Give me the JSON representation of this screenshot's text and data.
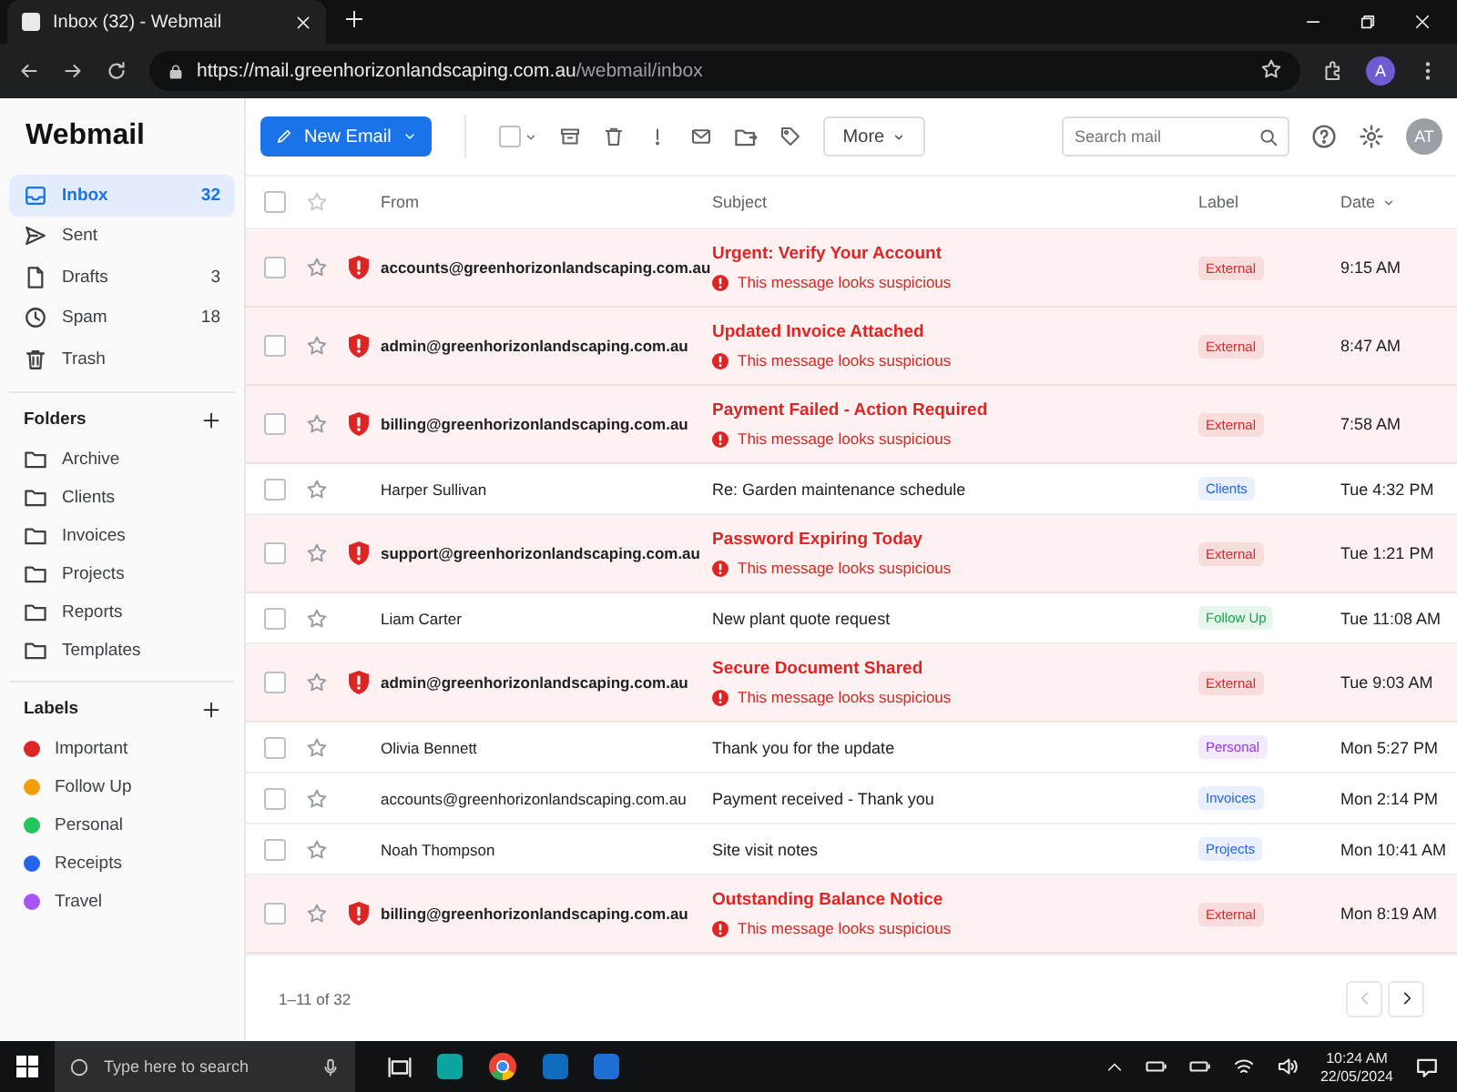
{
  "browser": {
    "tab_title": "Inbox (32) - Webmail",
    "url_host": "https://mail.greenhorizonlandscaping.com.au",
    "url_path": "/webmail/inbox",
    "profile": "A"
  },
  "app": {
    "title": "Webmail",
    "new_button": "New Email",
    "select_all": {
      "checked": false
    },
    "more_button": "More",
    "search": {
      "placeholder": "Search mail"
    },
    "avatar": "AT"
  },
  "sidebar": {
    "nav": [
      {
        "label": "Inbox",
        "count": "32",
        "selected": true,
        "kind": "inbox"
      },
      {
        "label": "Sent",
        "selected": false,
        "kind": "sent"
      },
      {
        "label": "Drafts",
        "count": "3",
        "selected": false,
        "kind": "drafts"
      },
      {
        "label": "Spam",
        "count": "18",
        "selected": false,
        "kind": "spam"
      },
      {
        "label": "Trash",
        "selected": false,
        "kind": "trash"
      }
    ],
    "folders_heading": "Folders",
    "folders": [
      "Archive",
      "Clients",
      "Invoices",
      "Projects",
      "Reports",
      "Templates"
    ],
    "labels_heading": "Labels",
    "labels": [
      {
        "name": "Important",
        "color": "#dc2626"
      },
      {
        "name": "Follow Up",
        "color": "#f59e0b"
      },
      {
        "name": "Personal",
        "color": "#22c55e"
      },
      {
        "name": "Receipts",
        "color": "#2563eb"
      },
      {
        "name": "Travel",
        "color": "#a855f7"
      }
    ]
  },
  "table": {
    "select_all": {
      "checked": false
    },
    "columns": [
      "From",
      "Subject",
      "Label",
      "Date"
    ],
    "rows": [
      {
        "checked": false,
        "from": "accounts@greenhorizonlandscaping.com.au",
        "subject": "Urgent: Verify Your Account",
        "suspicious": true,
        "warning": "This message looks suspicious",
        "label": {
          "text": "External",
          "color": "#dc2626"
        },
        "date": "9:15 AM"
      },
      {
        "checked": false,
        "from": "admin@greenhorizonlandscaping.com.au",
        "subject": "Updated Invoice Attached",
        "suspicious": true,
        "warning": "This message looks suspicious",
        "label": {
          "text": "External",
          "color": "#dc2626"
        },
        "date": "8:47 AM"
      },
      {
        "checked": false,
        "from": "billing@greenhorizonlandscaping.com.au",
        "subject": "Payment Failed - Action Required",
        "suspicious": true,
        "warning": "This message looks suspicious",
        "label": {
          "text": "External",
          "color": "#dc2626"
        },
        "date": "7:58 AM"
      },
      {
        "checked": false,
        "from": "Harper Sullivan",
        "subject": "Re: Garden maintenance schedule",
        "suspicious": false,
        "label": {
          "text": "Clients",
          "color": "#2563eb"
        },
        "date": "Tue 4:32 PM"
      },
      {
        "checked": false,
        "from": "support@greenhorizonlandscaping.com.au",
        "subject": "Password Expiring Today",
        "suspicious": true,
        "warning": "This message looks suspicious",
        "label": {
          "text": "External",
          "color": "#dc2626"
        },
        "date": "Tue 1:21 PM"
      },
      {
        "checked": false,
        "from": "Liam Carter",
        "subject": "New plant quote request",
        "suspicious": false,
        "label": {
          "text": "Follow Up",
          "color": "#16a34a"
        },
        "date": "Tue 11:08 AM"
      },
      {
        "checked": false,
        "from": "admin@greenhorizonlandscaping.com.au",
        "subject": "Secure Document Shared",
        "suspicious": true,
        "warning": "This message looks suspicious",
        "label": {
          "text": "External",
          "color": "#dc2626"
        },
        "date": "Tue 9:03 AM"
      },
      {
        "checked": false,
        "from": "Olivia Bennett",
        "subject": "Thank you for the update",
        "suspicious": false,
        "label": {
          "text": "Personal",
          "color": "#9333ea"
        },
        "date": "Mon 5:27 PM"
      },
      {
        "checked": false,
        "from": "accounts@greenhorizonlandscaping.com.au",
        "subject": "Payment received - Thank you",
        "suspicious": false,
        "label": {
          "text": "Invoices",
          "color": "#2563eb"
        },
        "date": "Mon 2:14 PM"
      },
      {
        "checked": false,
        "from": "Noah Thompson",
        "subject": "Site visit notes",
        "suspicious": false,
        "label": {
          "text": "Projects",
          "color": "#2563eb"
        },
        "date": "Mon 10:41 AM"
      },
      {
        "checked": false,
        "from": "billing@greenhorizonlandscaping.com.au",
        "subject": "Outstanding Balance Notice",
        "suspicious": true,
        "warning": "This message looks suspicious",
        "label": {
          "text": "External",
          "color": "#dc2626"
        },
        "date": "Mon 8:19 AM"
      }
    ],
    "footer": "1–11 of 32"
  },
  "taskbar": {
    "search_placeholder": "Type here to search",
    "time": "10:24 AM",
    "date": "22/05/2024"
  }
}
